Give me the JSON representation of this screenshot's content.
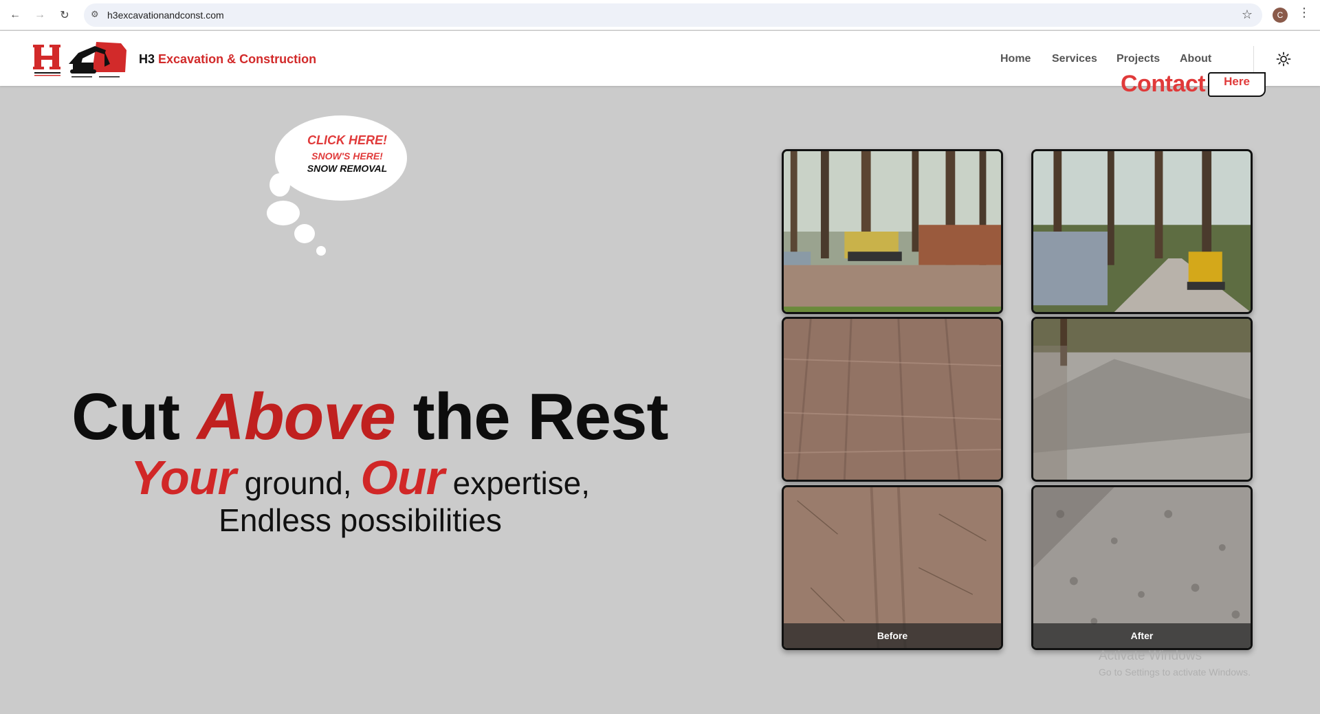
{
  "browser": {
    "url": "h3excavationandconst.com",
    "profile_initial": "C"
  },
  "header": {
    "brand_prefix": "H3",
    "brand_name": "Excavation & Construction",
    "nav": [
      "Home",
      "Services",
      "Projects",
      "About"
    ],
    "contact_label": "Contact",
    "here_label": "Here"
  },
  "bubble": {
    "line1": "CLICK HERE!",
    "line2": "SNOW'S HERE!",
    "line3": "SNOW REMOVAL"
  },
  "hero": {
    "title_part1": "Cut",
    "title_emphasis": "Above",
    "title_part2": "the Rest",
    "sub_your": "Your",
    "sub_ground": "ground,",
    "sub_our": "Our",
    "sub_rest": "expertise, Endless possibilities"
  },
  "gallery": {
    "before_label": "Before",
    "after_label": "After"
  },
  "watermark": {
    "line1": "Activate Windows",
    "line2": "Go to Settings to activate Windows."
  },
  "colors": {
    "brand_red": "#d22a2a",
    "hero_bg": "#cbcbcb",
    "photo_border_accent": "#2fbf60"
  }
}
